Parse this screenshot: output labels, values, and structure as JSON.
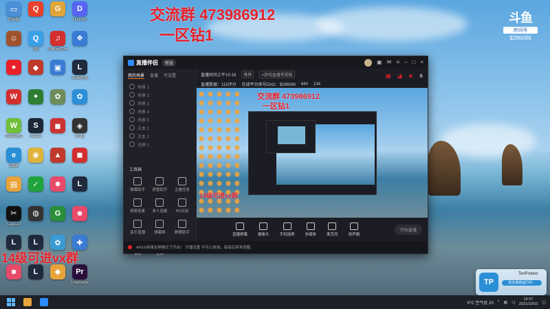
{
  "overlay": {
    "group_line": "交流群 473986912",
    "zone_line": "一区钻1",
    "bottom_left": "14级可进vx群"
  },
  "douyu": {
    "mark": "斗鱼",
    "room_label": "房间号",
    "room_id": "$296096"
  },
  "desktop_icons": [
    {
      "label": "此电脑",
      "color": "#4b8fd6",
      "glyph": "▭"
    },
    {
      "label": "",
      "color": "#e8402a",
      "glyph": "Q"
    },
    {
      "label": "",
      "color": "#e0a53a",
      "glyph": "G"
    },
    {
      "label": "Discord",
      "color": "#5865f2",
      "glyph": "D"
    },
    {
      "label": "",
      "color": "#a0522d",
      "glyph": "☺"
    },
    {
      "label": "QQ",
      "color": "#3aa0e8",
      "glyph": "Q"
    },
    {
      "label": "网易云音乐",
      "color": "#d32f2f",
      "glyph": "♫"
    },
    {
      "label": "",
      "color": "#3a7bd5",
      "glyph": "❖"
    },
    {
      "label": "",
      "color": "#e8202a",
      "glyph": "●"
    },
    {
      "label": "",
      "color": "#c03a2b",
      "glyph": "◆"
    },
    {
      "label": "",
      "color": "#3a7bd5",
      "glyph": "▣"
    },
    {
      "label": "英雄联盟",
      "color": "#1f2a3c",
      "glyph": "L"
    },
    {
      "label": "",
      "color": "#d32f2f",
      "glyph": "W"
    },
    {
      "label": "",
      "color": "#2e7d32",
      "glyph": "✦"
    },
    {
      "label": "",
      "color": "#6d8c5a",
      "glyph": "✿"
    },
    {
      "label": "",
      "color": "#2a8fd6",
      "glyph": "✿"
    },
    {
      "label": "WeGame",
      "color": "#6fbf3a",
      "glyph": "W"
    },
    {
      "label": "Steam",
      "color": "#1b2838",
      "glyph": "S"
    },
    {
      "label": "",
      "color": "#c33",
      "glyph": "◼"
    },
    {
      "label": "Unity",
      "color": "#333",
      "glyph": "◈"
    },
    {
      "label": "Edge",
      "color": "#2a8fd6",
      "glyph": "e"
    },
    {
      "label": "",
      "color": "#e0b33a",
      "glyph": "◉"
    },
    {
      "label": "",
      "color": "#c0392b",
      "glyph": "▲"
    },
    {
      "label": "",
      "color": "#d32f2f",
      "glyph": "◼"
    },
    {
      "label": "",
      "color": "#e8a33a",
      "glyph": "▤"
    },
    {
      "label": "",
      "color": "#1fa33a",
      "glyph": "✓"
    },
    {
      "label": "",
      "color": "#e84a6a",
      "glyph": "☻"
    },
    {
      "label": "",
      "color": "#1f2a3c",
      "glyph": "L"
    },
    {
      "label": "CapCut",
      "color": "#111",
      "glyph": "✂"
    },
    {
      "label": "",
      "color": "#333",
      "glyph": "◍"
    },
    {
      "label": "",
      "color": "#2a8f3a",
      "glyph": "G"
    },
    {
      "label": "",
      "color": "#e84a6a",
      "glyph": "☻"
    },
    {
      "label": "",
      "color": "#1f2a3c",
      "glyph": "L"
    },
    {
      "label": "",
      "color": "#1f2a3c",
      "glyph": "L"
    },
    {
      "label": "",
      "color": "#3a9bd5",
      "glyph": "✿"
    },
    {
      "label": "",
      "color": "#3a7bd5",
      "glyph": "✚"
    },
    {
      "label": "",
      "color": "#e84a6a",
      "glyph": "☻"
    },
    {
      "label": "",
      "color": "#1f2a3c",
      "glyph": "L"
    },
    {
      "label": "",
      "color": "#e8a33a",
      "glyph": "◆"
    },
    {
      "label": "Premiere",
      "color": "#2a0f3c",
      "glyph": "Pr"
    },
    {
      "label": "",
      "color": "#e8802a",
      "glyph": "⚡"
    },
    {
      "label": "",
      "color": "#1f2a3c",
      "glyph": "L"
    },
    {
      "label": "",
      "color": "#1fa33a",
      "glyph": "▶"
    },
    {
      "label": "",
      "color": "#3a9bd5",
      "glyph": "◉"
    },
    {
      "label": "",
      "color": "#c9a23a",
      "glyph": "◈"
    },
    {
      "label": "",
      "color": "#e84a6a",
      "glyph": "◐"
    },
    {
      "label": "",
      "color": "#c0392b",
      "glyph": "◆"
    },
    {
      "label": "",
      "color": "#3a7bd5",
      "glyph": "◎"
    },
    {
      "label": "",
      "color": "#2a8fd6",
      "glyph": "e"
    }
  ],
  "app": {
    "name": "直播伴侣",
    "version": "新版",
    "tabs": [
      "我的场景",
      "直播",
      "可设置"
    ],
    "scenes": [
      "场景 1",
      "场景 2",
      "场景 3",
      "场景 4",
      "场景 5",
      "文本 1",
      "文本 2",
      "全屏 1"
    ],
    "tools_title": "工具箱",
    "tools": [
      "弹幕助手",
      "房管助手",
      "主播任务",
      "视频连麦",
      "多人连麦",
      "PK对战",
      "音乐直播",
      "弹幕姬",
      "数据助手",
      "录屏",
      "投屏",
      ""
    ],
    "room": {
      "title": "直播时间上午10-18",
      "tag1": "推荐",
      "tag2": "#游戏直播常规版",
      "line2_a": "直播数据：115评分",
      "line2_b": "在线平台房号DAG：$296096",
      "line2_c": "640",
      "line2_d": "134"
    },
    "toolbar": [
      "直播屏幕",
      "摄像头",
      "手机投屏",
      "多媒体",
      "麦克风",
      "扬声器"
    ],
    "start_label": "开始直播",
    "status_text": "APEX英雄全屏模式下开启！  开播设置 不可以单独，每局后再来调整。"
  },
  "popup": {
    "title": "TenProtect",
    "badge": "TP",
    "status": "安全系统运行中..."
  },
  "tray": {
    "weather": "9°C 空气优 20",
    "time": "10:27",
    "date": "2021/10/10"
  }
}
